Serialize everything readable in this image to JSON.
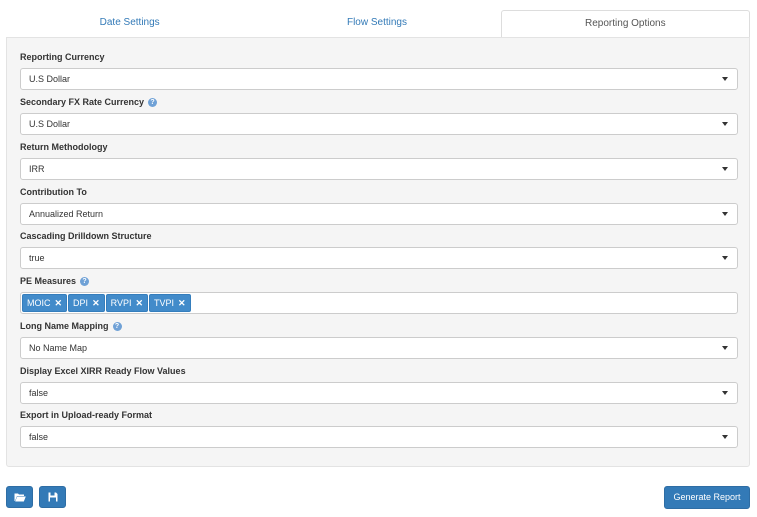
{
  "tabs": [
    {
      "label": "Date Settings"
    },
    {
      "label": "Flow Settings"
    },
    {
      "label": "Reporting Options"
    }
  ],
  "fields": {
    "reporting_currency": {
      "label": "Reporting Currency",
      "value": "U.S Dollar"
    },
    "secondary_fx": {
      "label": "Secondary FX Rate Currency",
      "value": "U.S Dollar"
    },
    "return_methodology": {
      "label": "Return Methodology",
      "value": "IRR"
    },
    "contribution_to": {
      "label": "Contribution To",
      "value": "Annualized Return"
    },
    "cascading_drilldown": {
      "label": "Cascading Drilldown Structure",
      "value": "true"
    },
    "pe_measures": {
      "label": "PE Measures",
      "tags": [
        "MOIC",
        "DPI",
        "RVPI",
        "TVPI"
      ]
    },
    "long_name_mapping": {
      "label": "Long Name Mapping",
      "value": "No Name Map"
    },
    "excel_xirr": {
      "label": "Display Excel XIRR Ready Flow Values",
      "value": "false"
    },
    "export_upload": {
      "label": "Export in Upload-ready Format",
      "value": "false"
    }
  },
  "icons": {
    "help": "?",
    "remove": "✕"
  },
  "buttons": {
    "generate_report": "Generate Report"
  },
  "colors": {
    "primary": "#337ab7",
    "tag": "#428bca",
    "help": "#6fa1d6"
  }
}
